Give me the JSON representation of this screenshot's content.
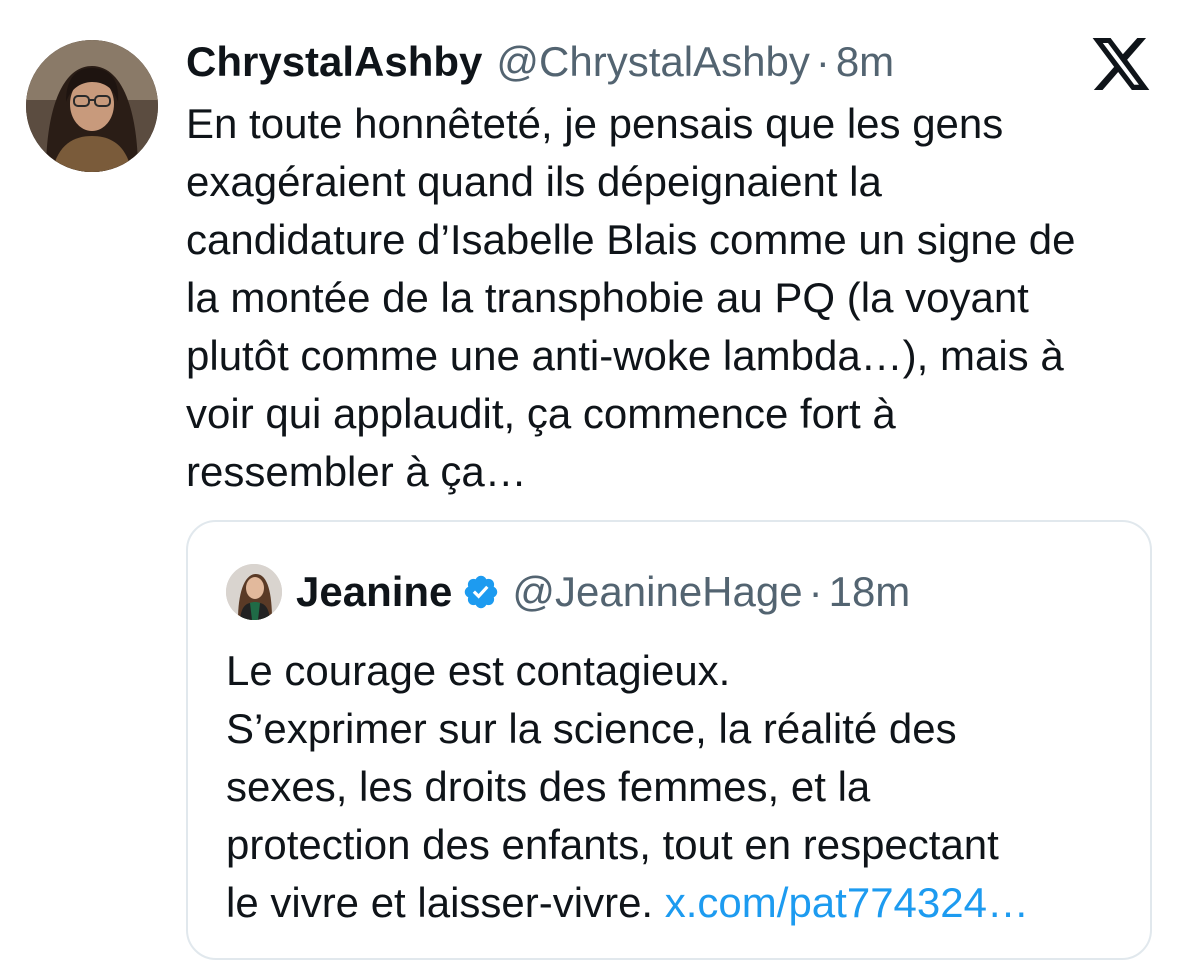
{
  "tweet": {
    "author": {
      "display_name": "ChrystalAshby",
      "handle": "@ChrystalAshby",
      "separator": "·",
      "time": "8m"
    },
    "platform_icon": "x-logo-icon",
    "text_lines": [
      "En toute honnêteté, je pensais que les gens",
      "exagéraient quand ils dépeignaient la",
      "candidature d’Isabelle Blais comme un signe de",
      "la montée de la transphobie au PQ (la voyant",
      "plutôt comme une anti-woke lambda…), mais à",
      "voir qui applaudit, ça commence fort à",
      "ressembler à ça…"
    ]
  },
  "quote": {
    "author": {
      "display_name": "Jeanine",
      "verified_icon": "verified-badge-icon",
      "handle": "@JeanineHage",
      "separator": "·",
      "time": "18m"
    },
    "text_lines": [
      "Le courage est contagieux.",
      "S’exprimer sur la science, la réalité des",
      "sexes, les droits des femmes, et la",
      "protection des enfants, tout en respectant"
    ],
    "last_line_text": "le vivre et laisser-vivre. ",
    "link_text": "x.com/pat774324…"
  },
  "colors": {
    "text": "#0f1419",
    "secondary": "#536471",
    "link": "#1d9bf0",
    "verified": "#1d9bf0",
    "border": "#e1e8ed"
  }
}
